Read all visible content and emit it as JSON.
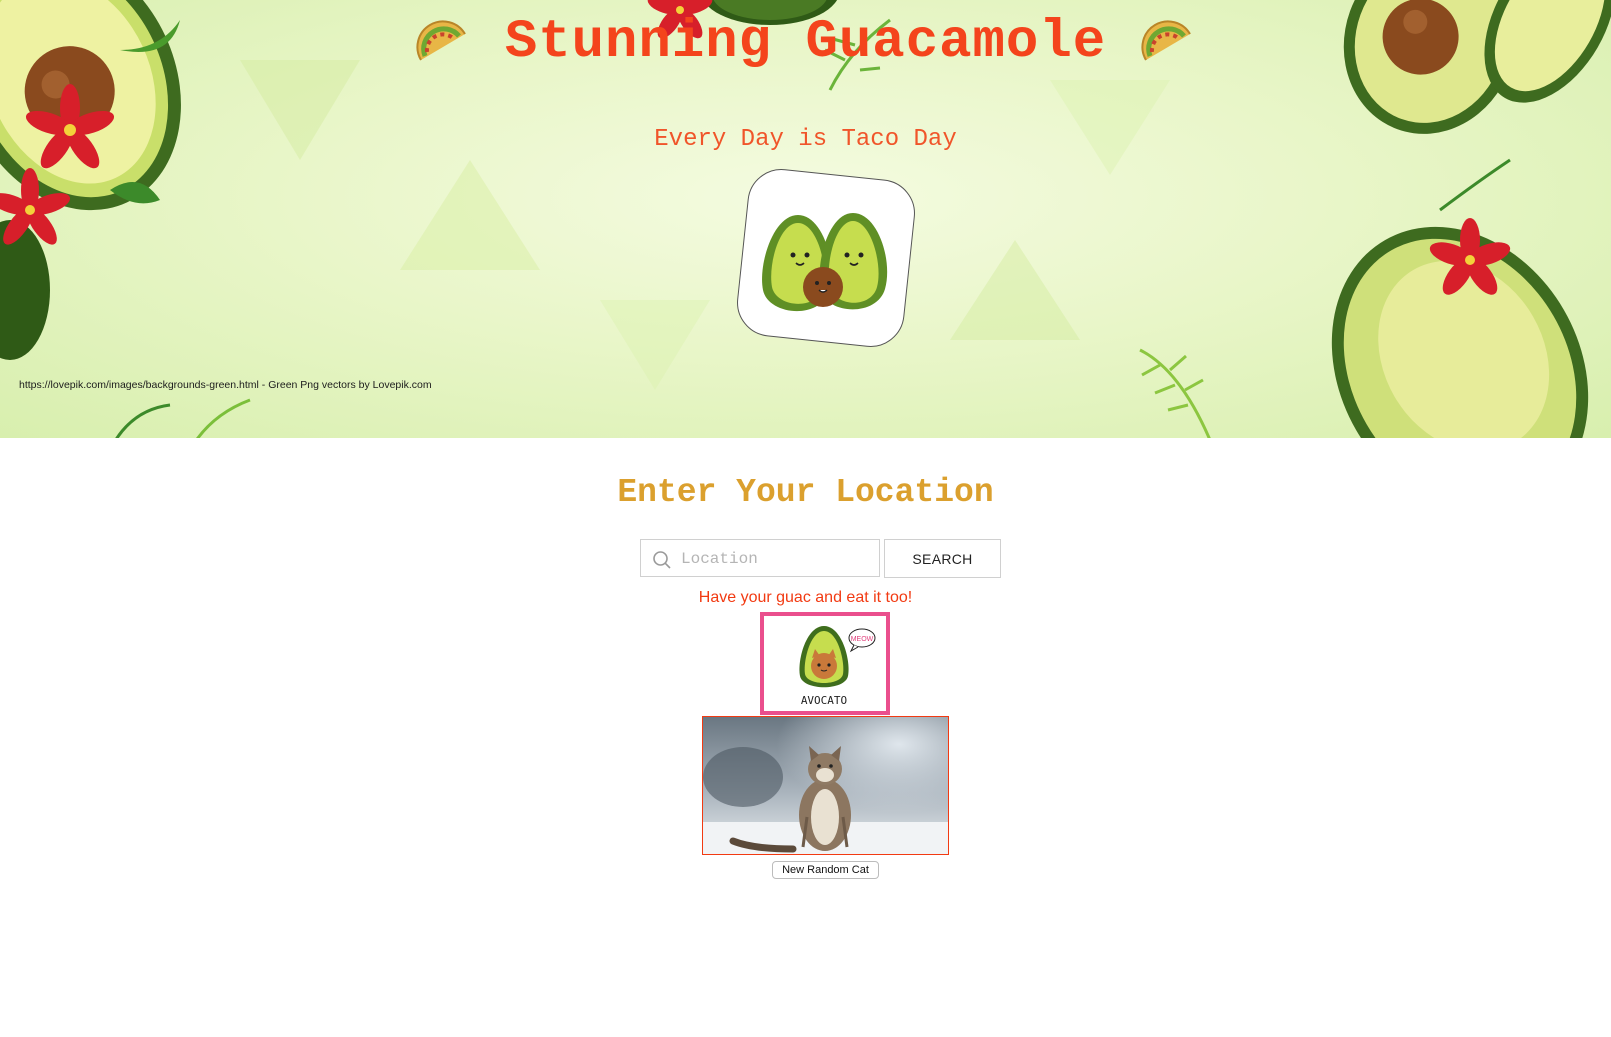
{
  "header": {
    "title": "Stunning Guacamole",
    "tagline": "Every Day is Taco Day",
    "credit": "https://lovepik.com/images/backgrounds-green.html - Green Png vectors by Lovepik.com",
    "icons": [
      "taco-icon",
      "avocado-couple-icon"
    ]
  },
  "location": {
    "heading": "Enter Your Location",
    "placeholder": "Location",
    "value": "",
    "search_label": "SEARCH"
  },
  "promo": {
    "text": "Have your guac and eat it too!",
    "avocato_caption": "AVOCATO",
    "avocato_bubble": "MEOW"
  },
  "cat": {
    "new_cat_label": "New Random Cat"
  },
  "colors": {
    "title": "#f4441c",
    "heading": "#dba02e",
    "promo": "#f23a12",
    "avocato_border": "#ea4f8d"
  }
}
